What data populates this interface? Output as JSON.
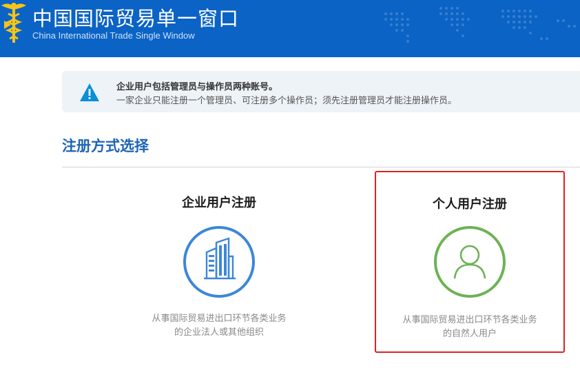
{
  "header": {
    "title_cn": "中国国际贸易单一窗口",
    "title_en": "China International Trade Single  Window",
    "bg_color": "#0b63c5"
  },
  "notice": {
    "icon": "warning-icon",
    "line1": "企业用户包括管理员与操作员两种账号。",
    "line2": "一家企业只能注册一个管理员、可注册多个操作员；须先注册管理员才能注册操作员。"
  },
  "section": {
    "title": "注册方式选择"
  },
  "cards": {
    "enterprise": {
      "title": "企业用户注册",
      "icon": "building-icon",
      "desc_line1": "从事国际贸易进出口环节各类业务",
      "desc_line2": "的企业法人或其他组织",
      "accent": "#3b87d8"
    },
    "personal": {
      "title": "个人用户注册",
      "icon": "person-icon",
      "desc_line1": "从事国际贸易进出口环节各类业务",
      "desc_line2": "的自然人用户",
      "accent": "#6db254"
    }
  }
}
